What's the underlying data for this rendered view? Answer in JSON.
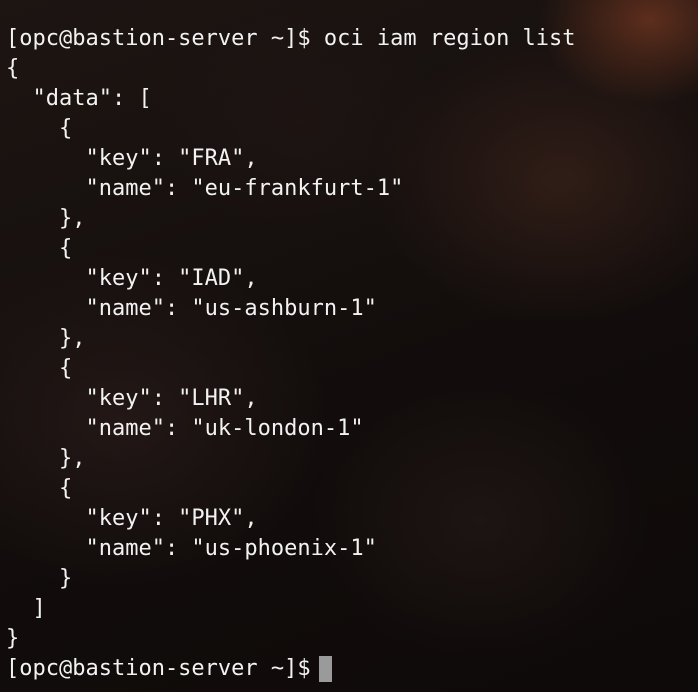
{
  "terminal": {
    "lines": [
      "[opc@bastion-server ~]$ oci iam region list",
      "{",
      "  \"data\": [",
      "    {",
      "      \"key\": \"FRA\",",
      "      \"name\": \"eu-frankfurt-1\"",
      "    },",
      "    {",
      "      \"key\": \"IAD\",",
      "      \"name\": \"us-ashburn-1\"",
      "    },",
      "    {",
      "      \"key\": \"LHR\",",
      "      \"name\": \"uk-london-1\"",
      "    },",
      "    {",
      "      \"key\": \"PHX\",",
      "      \"name\": \"us-phoenix-1\"",
      "    }",
      "  ]",
      "}"
    ],
    "prompt": "[opc@bastion-server ~]$"
  }
}
